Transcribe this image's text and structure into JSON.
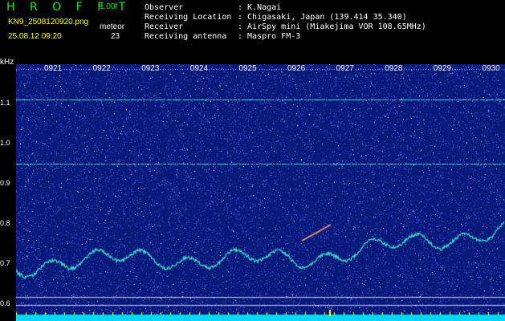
{
  "app": {
    "title": "H R O F F T",
    "version": "1.00f"
  },
  "file": {
    "name": "KN9_2508120920.png",
    "timestamp": "25.08.12 09:20"
  },
  "meteor": {
    "label": "meteor",
    "count": "23"
  },
  "info": [
    {
      "key": "Observer",
      "value": ": K.Nagai"
    },
    {
      "key": "Receiving Location",
      "value": ": Chigasaki, Japan (139.414 35.340)"
    },
    {
      "key": "Receiver",
      "value": ": AirSpy mini (Miakejima VOR 108.65MHz)"
    },
    {
      "key": "Receiving antenna",
      "value": ": Maspro FM-3"
    }
  ],
  "axis": {
    "unit": "kHz",
    "freq_labels": [
      "1.1",
      "1.0",
      "0.9",
      "0.8",
      "0.7",
      "0.6"
    ],
    "time_labels": [
      "0921",
      "0922",
      "0923",
      "0924",
      "0925",
      "0926",
      "0927",
      "0928",
      "0929",
      "0930"
    ]
  },
  "colors": {
    "background": "#0a1a7a",
    "noise": "#3a4fd0",
    "signal": "#3fe6d0",
    "accent": "#19e619",
    "highlight": "#ffff00",
    "baseline": "#00d8ff"
  }
}
